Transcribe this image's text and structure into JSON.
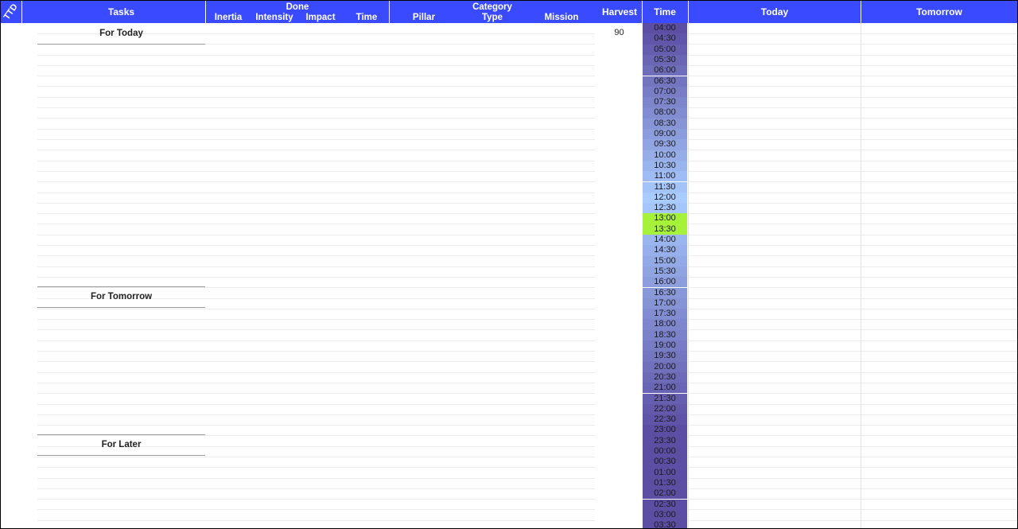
{
  "header": {
    "ttd": "TTD",
    "tasks": "Tasks",
    "done": "Done",
    "done_cols": [
      "Inertia",
      "Intensity",
      "Impact",
      "Time"
    ],
    "category": "Category",
    "category_cols": [
      "Pillar",
      "Type",
      "Mission"
    ],
    "harvest": "Harvest",
    "time": "Time",
    "today": "Today",
    "tomorrow": "Tomorrow"
  },
  "sections": {
    "for_today": "For Today",
    "for_tomorrow": "For Tomorrow",
    "for_later": "For Later"
  },
  "harvest_value": "90",
  "time_slots": [
    "04:00",
    "04:30",
    "05:00",
    "05:30",
    "06:00",
    "06:30",
    "07:00",
    "07:30",
    "08:00",
    "08:30",
    "09:00",
    "09:30",
    "10:00",
    "10:30",
    "11:00",
    "11:30",
    "12:00",
    "12:30",
    "13:00",
    "13:30",
    "14:00",
    "14:30",
    "15:00",
    "15:30",
    "16:00",
    "16:30",
    "17:00",
    "17:30",
    "18:00",
    "18:30",
    "19:00",
    "19:30",
    "20:00",
    "20:30",
    "21:00",
    "21:30",
    "22:00",
    "22:30",
    "23:00",
    "23:30",
    "00:00",
    "00:30",
    "01:00",
    "01:30",
    "02:00",
    "02:30",
    "03:00",
    "03:30"
  ],
  "current_slots": [
    "13:00",
    "13:30"
  ],
  "colors": {
    "header_bg": "#3a4bff",
    "current_slot": "#a6f23a",
    "night": "#5b4ea3",
    "midday": "#a9ccff"
  }
}
